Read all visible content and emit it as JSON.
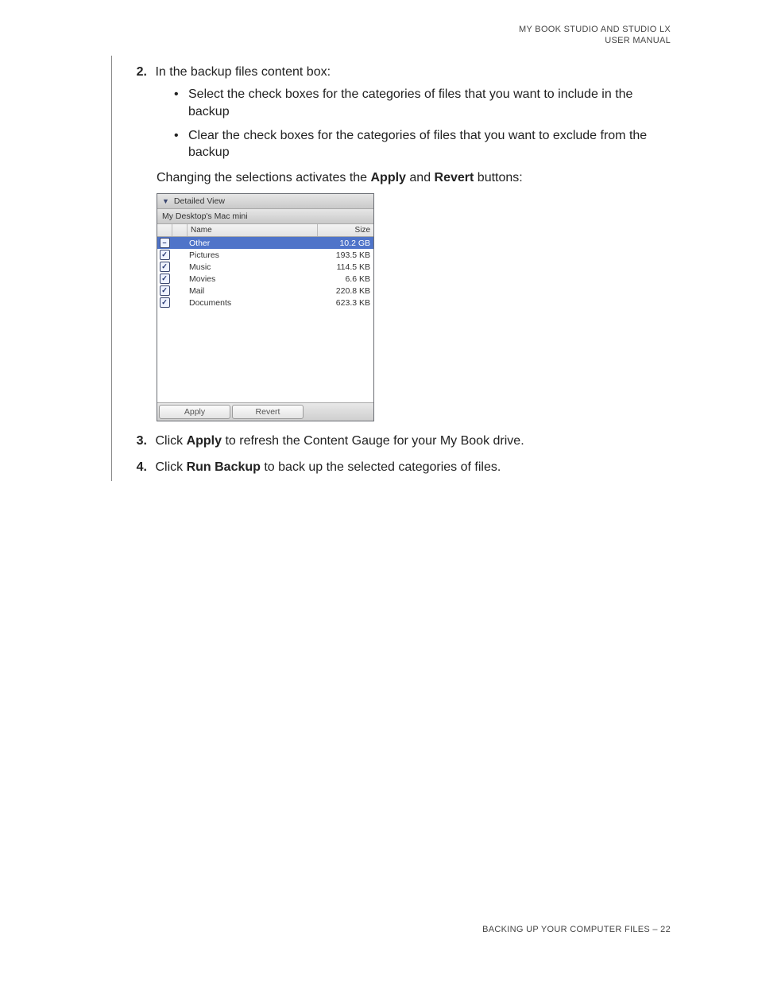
{
  "header": {
    "line1": "MY BOOK STUDIO AND  STUDIO LX",
    "line2": "USER MANUAL"
  },
  "step2": {
    "num": "2.",
    "intro": "In the backup files content box:",
    "bullets": [
      "Select the check boxes for the categories of files that you want to include in the backup",
      "Clear the check boxes for the categories of files that you want to exclude from the backup"
    ],
    "caption_pre": "Changing the selections activates the ",
    "caption_b1": "Apply",
    "caption_mid": " and ",
    "caption_b2": "Revert",
    "caption_post": " buttons:"
  },
  "shot": {
    "detailed": "Detailed View",
    "source": "My Desktop's Mac mini",
    "col_name": "Name",
    "col_size": "Size",
    "rows": [
      {
        "checked": "minus",
        "name": "Other",
        "size": "10.2 GB",
        "selected": true
      },
      {
        "checked": "check",
        "name": "Pictures",
        "size": "193.5 KB",
        "selected": false
      },
      {
        "checked": "check",
        "name": "Music",
        "size": "114.5 KB",
        "selected": false
      },
      {
        "checked": "check",
        "name": "Movies",
        "size": "6.6 KB",
        "selected": false
      },
      {
        "checked": "check",
        "name": "Mail",
        "size": "220.8 KB",
        "selected": false
      },
      {
        "checked": "check",
        "name": "Documents",
        "size": "623.3 KB",
        "selected": false
      }
    ],
    "apply": "Apply",
    "revert": "Revert"
  },
  "step3": {
    "num": "3.",
    "pre": "Click ",
    "b": "Apply",
    "post": " to refresh the Content Gauge for your My Book drive."
  },
  "step4": {
    "num": "4.",
    "pre": "Click ",
    "b": "Run Backup",
    "post": " to back up the selected categories of files."
  },
  "footer": "BACKING UP YOUR COMPUTER FILES – 22"
}
